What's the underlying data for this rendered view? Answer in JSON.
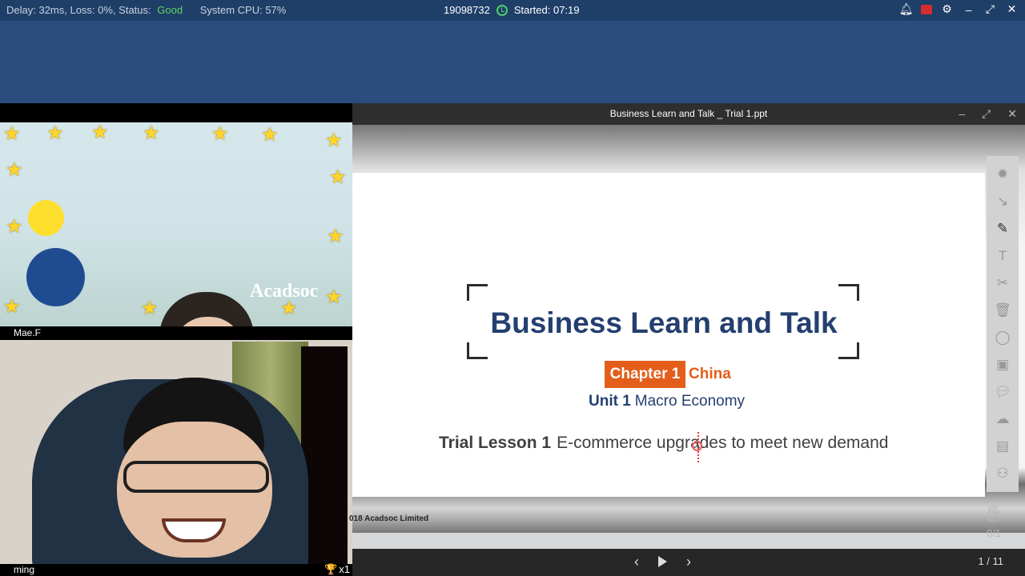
{
  "topbar": {
    "delay_label": "Delay: 32ms, Loss: 0%, Status:",
    "status": "Good",
    "cpu": "System CPU: 57%",
    "session_id": "19098732",
    "started": "Started: 07:19"
  },
  "teacher": {
    "name": "Mae.F",
    "backdrop_text": "Acadsoc"
  },
  "student": {
    "name": "ming",
    "trophy_count": "x1"
  },
  "presentation": {
    "window_title": "Business Learn and Talk _ Trial 1.ppt",
    "title": "Business Learn and Talk",
    "chapter_label": "Chapter 1",
    "chapter_name": "China",
    "unit_label": "Unit 1",
    "unit_name": "Macro Economy",
    "lesson_label": "Trial Lesson 1",
    "lesson_text": "E-commerce upgrades to meet new demand",
    "copyright": "018 Acadsoc Limited",
    "page": "1 / 11",
    "hand_count": "0/1"
  },
  "icons": {
    "bell": "bell-icon",
    "record": "record-icon",
    "settings": "gear-icon",
    "minimize": "minimize-icon",
    "maximize": "maximize-icon",
    "close": "close-icon",
    "clock": "clock-icon"
  },
  "colors": {
    "status_good": "#5fd35f",
    "slide_title": "#243f70",
    "chapter_accent": "#e35e1a",
    "topbar": "#1f3f68"
  }
}
